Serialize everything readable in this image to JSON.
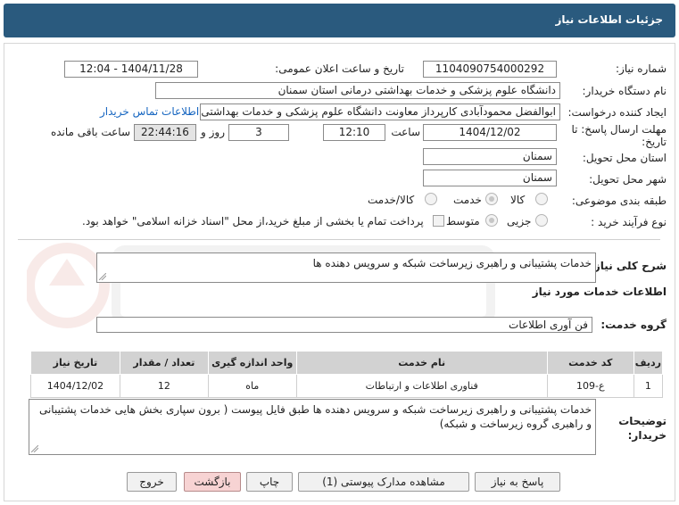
{
  "header": {
    "title": "جزئیات اطلاعات نیاز"
  },
  "fields": {
    "need_number_label": "شماره نیاز:",
    "need_number": "1104090754000292",
    "announce_label": "تاریخ و ساعت اعلان عمومی:",
    "announce_value": "1404/11/28 - 12:04",
    "buyer_org_label": "نام دستگاه خریدار:",
    "buyer_org": "دانشگاه علوم پزشکی و خدمات بهداشتی  درمانی استان سمنان",
    "requester_label": "ایجاد کننده درخواست:",
    "requester": "ابوالفضل  محمودآبادی کارپرداز معاونت  دانشگاه علوم پزشکی و خدمات بهداشتی",
    "contact_link": "اطلاعات تماس خریدار",
    "deadline_label_1": "مهلت ارسال پاسخ: تا",
    "deadline_label_2": "تاریخ:",
    "deadline_date": "1404/12/02",
    "hour_label": "ساعت",
    "deadline_time": "12:10",
    "days_count": "3",
    "days_label": "روز و",
    "remaining_time": "22:44:16",
    "remaining_label": "ساعت باقی مانده",
    "province_label": "استان محل تحویل:",
    "province": "سمنان",
    "city_label": "شهر محل تحویل:",
    "city": "سمنان",
    "category_label": "طبقه بندی موضوعی:",
    "category_options": [
      "کالا",
      "خدمت",
      "کالا/خدمت"
    ],
    "purchase_type_label": "نوع فرآیند خرید :",
    "purchase_options": [
      "جزیی",
      "متوسط"
    ],
    "purchase_note": "پرداخت تمام یا بخشی از مبلغ خرید،از محل \"اسناد خزانه اسلامی\" خواهد بود."
  },
  "summary": {
    "label": "شرح کلی نیاز:",
    "value": "خدمات پشتیبانی و راهبری زیرساخت شبکه و سرویس دهنده ها"
  },
  "services_title": "اطلاعات خدمات مورد نیاز",
  "service_group": {
    "label": "گروه خدمت:",
    "value": "فن آوری اطلاعات"
  },
  "table": {
    "headers": [
      "ردیف",
      "کد خدمت",
      "نام خدمت",
      "واحد اندازه گیری",
      "تعداد / مقدار",
      "تاریخ نیاز"
    ],
    "rows": [
      [
        "1",
        "ع-109",
        "فناوری اطلاعات و ارتباطات",
        "ماه",
        "12",
        "1404/12/02"
      ]
    ]
  },
  "buyer_notes": {
    "label_1": "توضیحات",
    "label_2": "خریدار:",
    "value": "خدمات پشتیبانی و راهبری زیرساخت شبکه و سرویس دهنده ها طبق فایل پیوست ( برون سپاری بخش هایی خدمات پشتیبانی و راهبری  گروه زیرساخت و  شبکه)"
  },
  "buttons": {
    "reply": "پاسخ به نیاز",
    "attachments": "مشاهده مدارک پیوستی (1)",
    "print": "چاپ",
    "back": "بازگشت",
    "exit": "خروج"
  },
  "colors": {
    "header_bg": "#2a5a7e",
    "link": "#1565c0",
    "button_pink": "#f7d3d3"
  }
}
